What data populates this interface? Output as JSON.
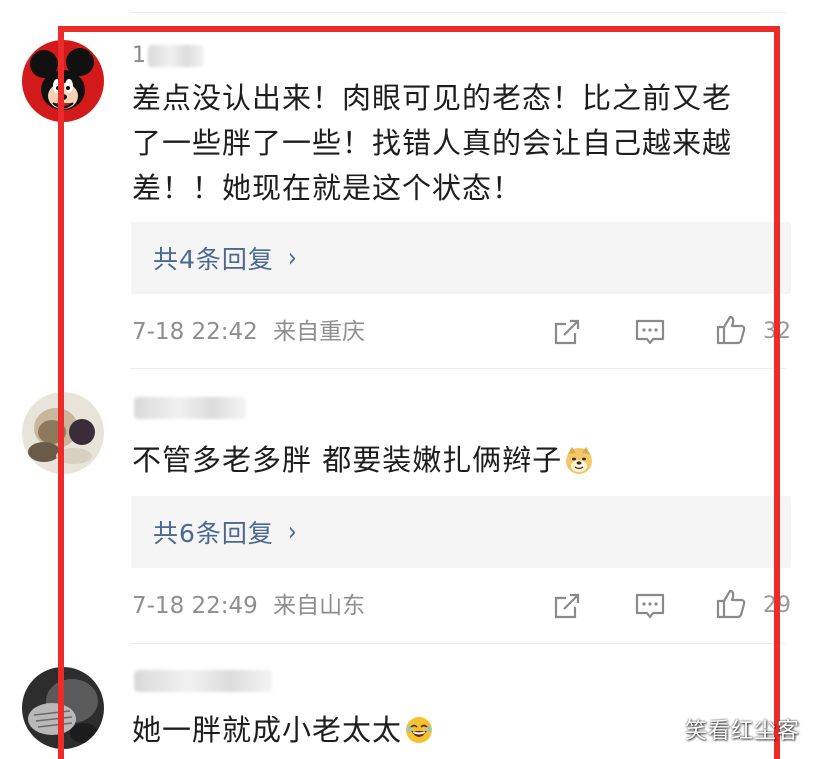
{
  "comments": [
    {
      "username_visible": "1",
      "text_lines": [
        "差点没认出来！肉眼可见的老态！比之前又老",
        "了一些胖了一些！找错人真的会让自己越来越",
        "差！！她现在就是这个状态！"
      ],
      "reply_link": "共4条回复",
      "timestamp": "7-18 22:42",
      "location": "来自重庆",
      "like_count": "32",
      "avatar_icon": "cartoon-mouse-avatar",
      "avatar_color": "#d21a1a"
    },
    {
      "username_visible": "",
      "text": "不管多老多胖 都要装嫩扎俩辫子",
      "emoji": "doge-emoji",
      "reply_link": "共6条回复",
      "timestamp": "7-18 22:49",
      "location": "来自山东",
      "like_count": "29",
      "avatar_icon": "photo-avatar"
    },
    {
      "username_visible": "",
      "text": "她一胖就成小老太太",
      "emoji": "laughing-emoji",
      "avatar_icon": "photo-avatar-dark"
    }
  ],
  "action_icons": [
    "share-icon",
    "comment-icon",
    "like-icon"
  ],
  "colors": {
    "highlight_frame": "#ee2b2b",
    "reply_link": "#4a6891",
    "meta_text": "#8e8e8e"
  },
  "watermark": "笑看红尘客"
}
